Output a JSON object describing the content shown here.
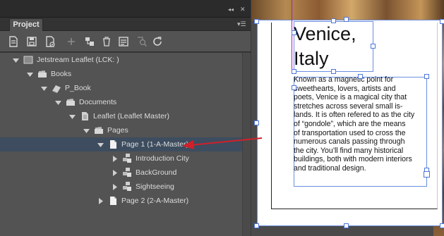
{
  "panel": {
    "tab_label": "Project",
    "collapse_glyph": "◂◂",
    "close_glyph": "✕",
    "menu_glyph": "▾☰"
  },
  "toolbar": {
    "tools": [
      "new-document-icon",
      "save-icon",
      "checkout-icon",
      "add-icon",
      "new-structure-icon",
      "delete-icon",
      "properties-icon",
      "find-icon",
      "refresh-icon"
    ]
  },
  "tree": {
    "items": [
      {
        "label": "Jetstream Leaflet (LCK: )",
        "icon": "project-icon"
      },
      {
        "label": "Books",
        "icon": "folder-icon"
      },
      {
        "label": "P_Book",
        "icon": "book-icon"
      },
      {
        "label": "Documents",
        "icon": "folder-icon"
      },
      {
        "label": "Leaflet (Leaflet Master)",
        "icon": "document-icon"
      },
      {
        "label": "Pages",
        "icon": "folder-icon"
      },
      {
        "label": "Page 1 (1-A-Master)",
        "icon": "page-icon"
      },
      {
        "label": "Introduction City",
        "icon": "component-icon"
      },
      {
        "label": "BackGround",
        "icon": "component-icon"
      },
      {
        "label": "Sightseeing",
        "icon": "component-icon"
      },
      {
        "label": "Page 2 (2-A-Master)",
        "icon": "page-icon"
      }
    ]
  },
  "document": {
    "title": "Venice, Italy",
    "body": "Known as a magnetic point for sweethearts, lovers, artists and poets, Venice is a magical city that stretches across several small islands. It is often refered to as the city of “gondole”, which are the means of transportation used to cross the numerous canals passing through the city. You’ll find many historical buildings, both with modern interiors and traditional design.",
    "title_lines": [
      "Venice,",
      "Italy"
    ],
    "body_lines": [
      "Known as a magnetic point for",
      "sweethearts, lovers, artists and",
      "poets, Venice is a magical city that",
      "stretches across several small is-",
      "lands. It is often refered to as the city",
      "of “gondole”, which are the means",
      "of transportation used to cross the",
      "numerous canals passing through",
      "the city. You’ll find many historical",
      "buildings, both with modern interiors",
      "and traditional design."
    ]
  },
  "colors": {
    "selection": "#3d4d5f",
    "annotation_arrow": "#d0202a",
    "frame_border": "#6b8fe0"
  }
}
